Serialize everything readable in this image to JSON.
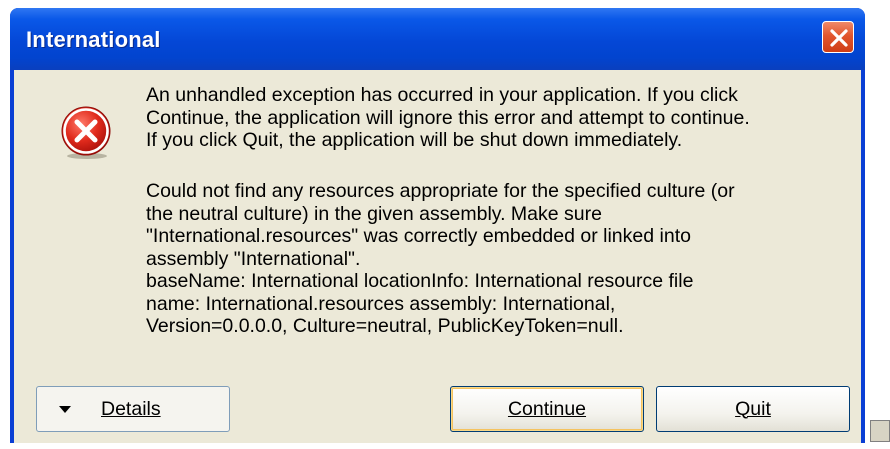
{
  "window": {
    "title": "International"
  },
  "message": {
    "summary": "An unhandled exception has occurred in your application. If you click\nContinue, the application will ignore this error and attempt to continue.\nIf you click Quit, the application will be shut down immediately.",
    "detail": "Could not find any resources appropriate for the specified culture (or\nthe neutral culture) in the given assembly.  Make sure\n\"International.resources\" was correctly embedded or linked into\nassembly \"International\".\nbaseName: International  locationInfo: International  resource file\nname: International.resources  assembly: International,\nVersion=0.0.0.0, Culture=neutral, PublicKeyToken=null."
  },
  "buttons": {
    "details_label": "Details",
    "continue_label": "Continue",
    "quit_label": "Quit"
  },
  "icons": {
    "status": "error-icon",
    "close": "close-icon"
  },
  "colors": {
    "titlebar": "#0447d6",
    "client": "#ece9d8",
    "close_button": "#e2562e",
    "error_icon": "#d41e1e"
  }
}
